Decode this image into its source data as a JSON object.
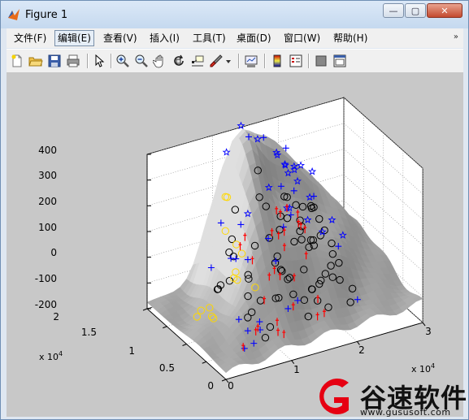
{
  "window": {
    "title": "Figure 1"
  },
  "title_buttons": {
    "minimize": "—",
    "maximize": "▢",
    "close": "✕"
  },
  "menu": [
    {
      "label": "文件(F)"
    },
    {
      "label": "编辑(E)"
    },
    {
      "label": "查看(V)"
    },
    {
      "label": "插入(I)"
    },
    {
      "label": "工具(T)"
    },
    {
      "label": "桌面(D)"
    },
    {
      "label": "窗口(W)"
    },
    {
      "label": "帮助(H)"
    }
  ],
  "menu_overflow_icon": "chevron-icon",
  "toolbar_icons": [
    "new-figure-icon",
    "open-file-icon",
    "save-icon",
    "print-icon",
    "pointer-icon",
    "zoom-in-icon",
    "zoom-out-icon",
    "pan-hand-icon",
    "rotate-3d-icon",
    "data-cursor-icon",
    "brush-icon",
    "dropdown-arrow-icon",
    "link-plot-icon",
    "colorbar-icon",
    "legend-icon",
    "hide-plot-tools-icon",
    "show-plot-tools-icon"
  ],
  "plot": {
    "z_ticks": [
      "400",
      "300",
      "200",
      "100",
      "0",
      "-100",
      "-200"
    ],
    "y_ticks": [
      "2",
      "1.5",
      "1",
      "0.5",
      "0"
    ],
    "x_ticks": [
      "0",
      "1",
      "2",
      "3"
    ],
    "y_exponent": "x 10",
    "y_exponent_power": "4",
    "x_exponent": "x 10",
    "x_exponent_power": "4"
  },
  "watermark": {
    "cn": "谷速软件",
    "url": "www.gususoft.com"
  },
  "colors": {
    "surface": "#8c8c8c",
    "blue_marker": "#0000ff",
    "red_marker": "#ff0000",
    "yellow_marker": "#ffd800",
    "black_marker": "#000000"
  }
}
